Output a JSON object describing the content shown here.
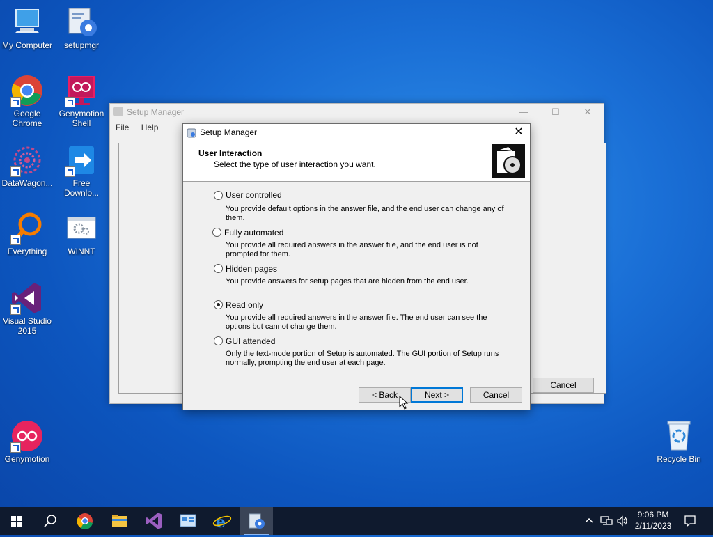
{
  "desktop": {
    "icons": [
      {
        "label": "My Computer"
      },
      {
        "label": "setupmgr"
      },
      {
        "label": "Google Chrome"
      },
      {
        "label": "Genymotion Shell"
      },
      {
        "label": "DataWagon..."
      },
      {
        "label": "Free Downlo..."
      },
      {
        "label": "Everything"
      },
      {
        "label": "WINNT"
      },
      {
        "label": "Visual Studio 2015"
      },
      {
        "label": "Genymotion"
      },
      {
        "label": "Recycle Bin"
      }
    ]
  },
  "bg_window": {
    "title": "Setup Manager",
    "menu_file": "File",
    "menu_help": "Help",
    "cancel": "Cancel"
  },
  "dialog": {
    "title": "Setup Manager",
    "header_title": "User Interaction",
    "header_subtitle": "Select the type of user interaction you want.",
    "options": [
      {
        "label": "User controlled",
        "desc": "You provide default options in the answer file, and the end user can change any of them.",
        "selected": false
      },
      {
        "label": "Fully automated",
        "desc": "You provide all required answers in the answer file, and the end user is not prompted for them.",
        "selected": false
      },
      {
        "label": "Hidden pages",
        "desc": "You provide answers for setup pages that are hidden from  the end user.",
        "selected": false
      },
      {
        "label": "Read only",
        "desc": "You provide all required answers in the answer file. The end user can see the options but cannot change them.",
        "selected": true
      },
      {
        "label": "GUI attended",
        "desc": "Only the text-mode portion of Setup is automated. The GUI portion of Setup runs normally, prompting the end user at each page.",
        "selected": false
      }
    ],
    "back": "< Back",
    "next": "Next >",
    "cancel": "Cancel"
  },
  "taskbar": {
    "time": "9:06 PM",
    "date": "2/11/2023"
  },
  "colors": {
    "accent": "#0078d7",
    "taskbar": "#0f1a2e"
  }
}
